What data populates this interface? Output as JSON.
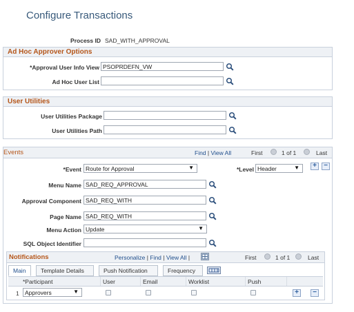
{
  "page_title": "Configure Transactions",
  "process_id": {
    "label": "Process ID",
    "value": "SAD_WITH_APPROVAL"
  },
  "adhoc": {
    "header": "Ad Hoc Approver Options",
    "user_info_view": {
      "label": "*Approval User Info View",
      "value": "PSOPRDEFN_VW"
    },
    "user_list": {
      "label": "Ad Hoc User List",
      "value": ""
    }
  },
  "utilities": {
    "header": "User Utilities",
    "package": {
      "label": "User Utilities Package",
      "value": ""
    },
    "path": {
      "label": "User Utilities Path",
      "value": ""
    }
  },
  "events": {
    "header": "Events",
    "nav": {
      "find": "Find",
      "view_all": "View All",
      "first": "First",
      "range": "1 of 1",
      "last": "Last"
    },
    "event": {
      "label": "*Event",
      "value": "Route for Approval"
    },
    "level": {
      "label": "*Level",
      "value": "Header"
    },
    "menu_name": {
      "label": "Menu Name",
      "value": "SAD_REQ_APPROVAL"
    },
    "approval_component": {
      "label": "Approval Component",
      "value": "SAD_REQ_WITH"
    },
    "page_name": {
      "label": "Page Name",
      "value": "SAD_REQ_WITH"
    },
    "menu_action": {
      "label": "Menu Action",
      "value": "Update"
    },
    "sql_object": {
      "label": "SQL Object Identifier",
      "value": ""
    }
  },
  "notifications": {
    "header": "Notifications",
    "nav": {
      "personalize": "Personalize",
      "find": "Find",
      "view_all": "View All",
      "first": "First",
      "range": "1 of 1",
      "last": "Last"
    },
    "tabs": [
      "Main",
      "Template Details",
      "Push Notification",
      "Frequency"
    ],
    "columns": [
      "*Participant",
      "User",
      "Email",
      "Worklist",
      "Push"
    ],
    "rows": [
      {
        "num": "1",
        "participant": "Approvers"
      }
    ]
  },
  "icons": {
    "lookup": "magnifier-icon",
    "first": "circle-left-icon",
    "last": "circle-right-icon",
    "add": "plus-icon",
    "remove": "minus-icon",
    "grid": "grid-icon"
  },
  "colors": {
    "section_header": "#b5561a",
    "title": "#37597a",
    "link": "#1f4e8c"
  }
}
